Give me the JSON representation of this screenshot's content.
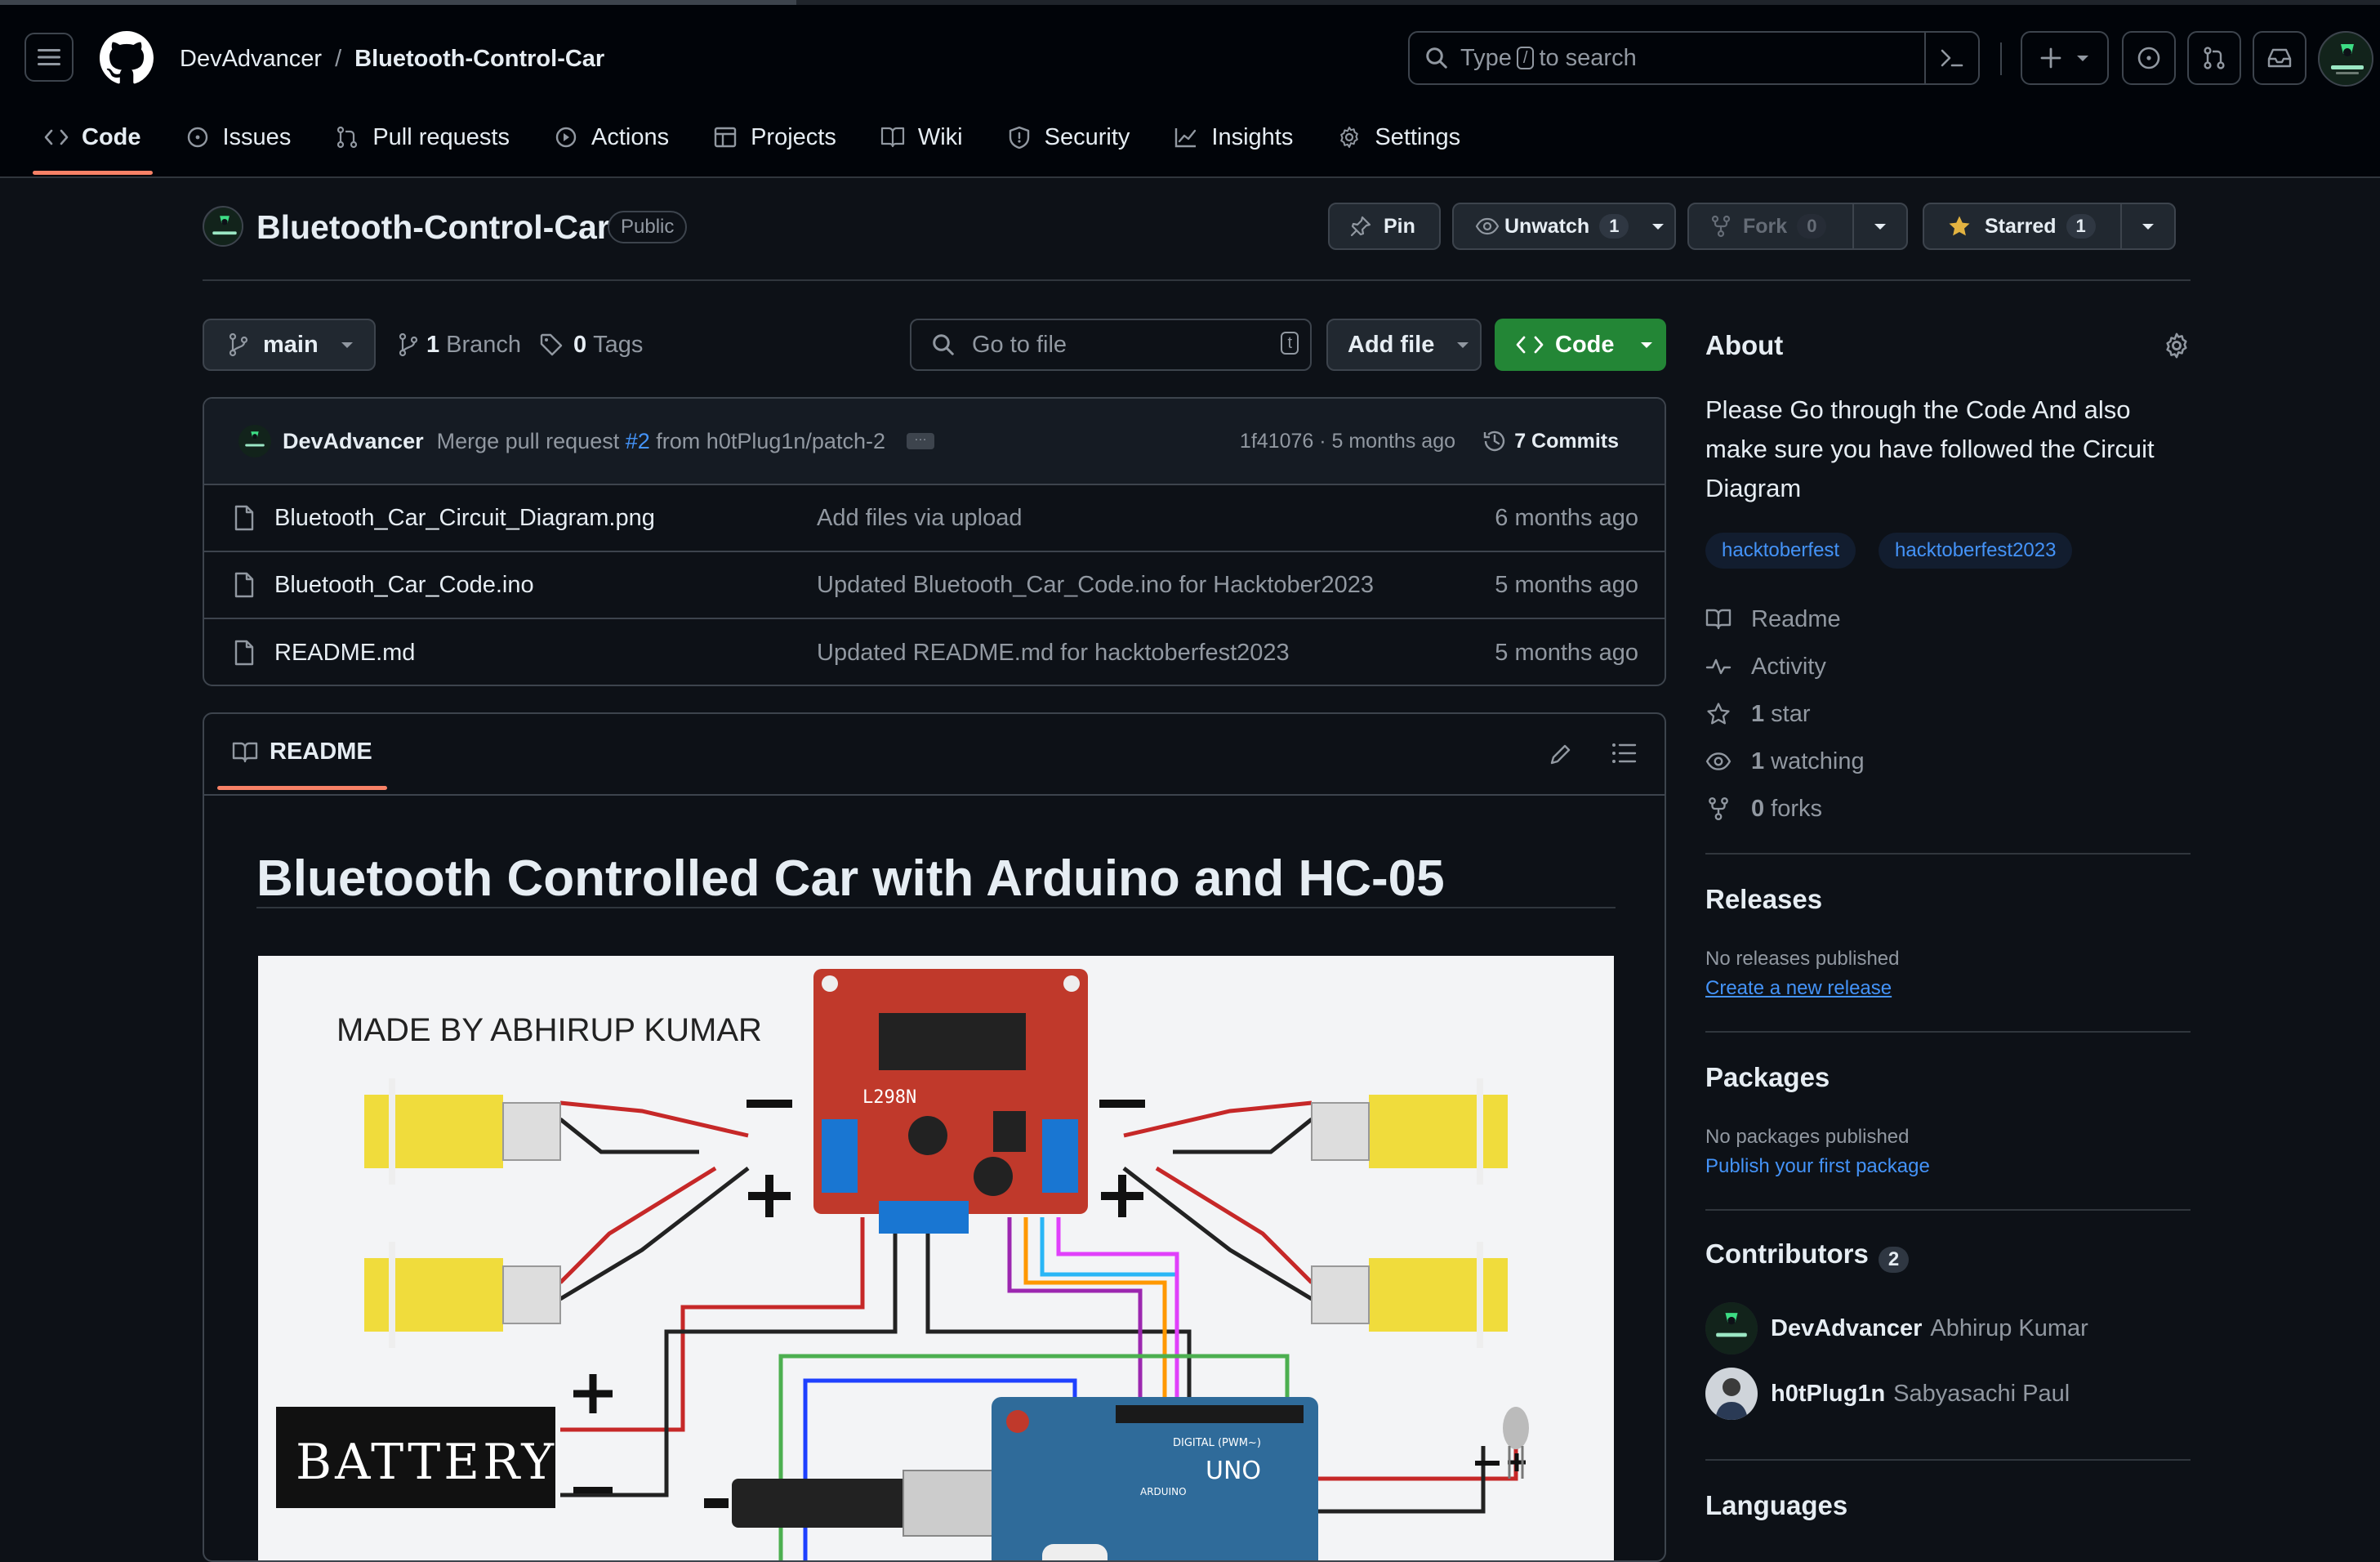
{
  "header": {
    "owner": "DevAdvancer",
    "separator": "/",
    "repo": "Bluetooth-Control-Car",
    "search_prefix": "Type",
    "search_key": "/",
    "search_suffix": "to search"
  },
  "tabs": [
    {
      "label": "Code",
      "icon": "code-icon",
      "active": true
    },
    {
      "label": "Issues",
      "icon": "issue-icon"
    },
    {
      "label": "Pull requests",
      "icon": "pull-request-icon"
    },
    {
      "label": "Actions",
      "icon": "play-icon"
    },
    {
      "label": "Projects",
      "icon": "table-icon"
    },
    {
      "label": "Wiki",
      "icon": "book-icon"
    },
    {
      "label": "Security",
      "icon": "shield-icon"
    },
    {
      "label": "Insights",
      "icon": "graph-icon"
    },
    {
      "label": "Settings",
      "icon": "gear-icon"
    }
  ],
  "repo": {
    "name": "Bluetooth-Control-Car",
    "visibility": "Public",
    "pin_label": "Pin",
    "watch_label": "Unwatch",
    "watch_count": "1",
    "fork_label": "Fork",
    "fork_count": "0",
    "star_label": "Starred",
    "star_count": "1"
  },
  "toolbar": {
    "branch": "main",
    "branch_count": "1",
    "branch_label": "Branch",
    "tag_count": "0",
    "tag_label": "Tags",
    "go_to_file": "Go to file",
    "go_to_file_key": "t",
    "add_file": "Add file",
    "code": "Code"
  },
  "commit": {
    "author": "DevAdvancer",
    "message_prefix": "Merge pull request",
    "pr": "#2",
    "message_suffix": "from h0tPlug1n/patch-2",
    "hash_time": "1f41076 · 5 months ago",
    "commits": "7 Commits"
  },
  "files": [
    {
      "name": "Bluetooth_Car_Circuit_Diagram.png",
      "message": "Add files via upload",
      "age": "6 months ago"
    },
    {
      "name": "Bluetooth_Car_Code.ino",
      "message": "Updated Bluetooth_Car_Code.ino for Hacktober2023",
      "age": "5 months ago"
    },
    {
      "name": "README.md",
      "message": "Updated README.md for hacktoberfest2023",
      "age": "5 months ago"
    }
  ],
  "readme": {
    "tab": "README",
    "title": "Bluetooth Controlled Car with Arduino and HC-05",
    "diagram_caption": "MADE BY ABHIRUP KUMAR",
    "diagram_battery": "BATTERY",
    "diagram_driver": "L298N",
    "diagram_board": "UNO",
    "diagram_board_brand": "ARDUINO",
    "diagram_digital": "DIGITAL (PWM~)"
  },
  "about": {
    "heading": "About",
    "description": "Please Go through the Code And also make sure you have followed the Circuit Diagram",
    "topics": [
      "hacktoberfest",
      "hacktoberfest2023"
    ],
    "readme": "Readme",
    "activity": "Activity",
    "stars_count": "1",
    "stars_label": "star",
    "watching_count": "1",
    "watching_label": "watching",
    "forks_count": "0",
    "forks_label": "forks"
  },
  "releases": {
    "heading": "Releases",
    "empty": "No releases published",
    "link": "Create a new release"
  },
  "packages": {
    "heading": "Packages",
    "empty": "No packages published",
    "link": "Publish your first package"
  },
  "contributors": {
    "heading": "Contributors",
    "count": "2",
    "list": [
      {
        "login": "DevAdvancer",
        "name": "Abhirup Kumar"
      },
      {
        "login": "h0tPlug1n",
        "name": "Sabyasachi Paul"
      }
    ]
  },
  "languages": {
    "heading": "Languages"
  },
  "colors": {
    "bg": "#0d1117",
    "header_bg": "#010409",
    "accent_link": "#4493f8",
    "tab_underline": "#f78166",
    "code_button": "#238636",
    "star": "#e3b341"
  }
}
